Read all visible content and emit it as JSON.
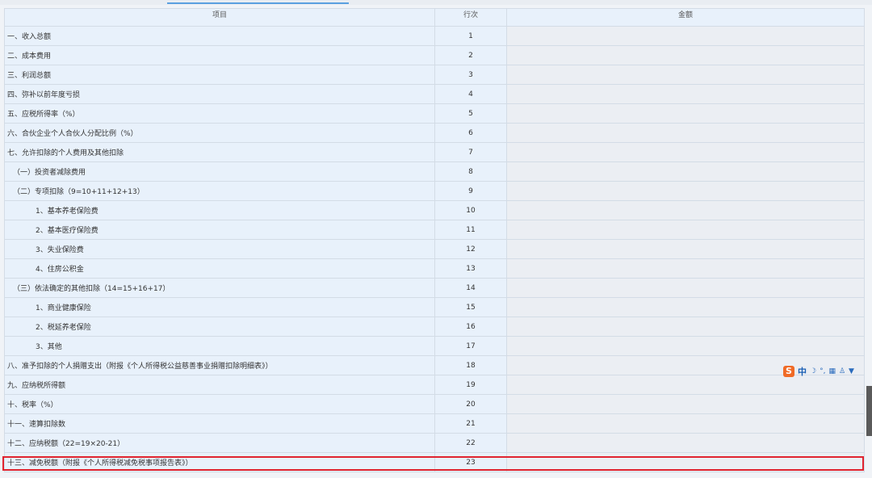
{
  "table": {
    "headers": {
      "item": "项目",
      "line": "行次",
      "amount": "金额"
    },
    "rows": [
      {
        "item": "一、收入总额",
        "line": "1",
        "indent": 0
      },
      {
        "item": "二、成本费用",
        "line": "2",
        "indent": 0
      },
      {
        "item": "三、利润总额",
        "line": "3",
        "indent": 0
      },
      {
        "item": "四、弥补以前年度亏损",
        "line": "4",
        "indent": 0
      },
      {
        "item": "五、应税所得率（%）",
        "line": "5",
        "indent": 0
      },
      {
        "item": "六、合伙企业个人合伙人分配比例（%）",
        "line": "6",
        "indent": 0
      },
      {
        "item": "七、允许扣除的个人费用及其他扣除",
        "line": "7",
        "indent": 0
      },
      {
        "item": "（一）投资者减除费用",
        "line": "8",
        "indent": 1
      },
      {
        "item": "（二）专项扣除（9=10+11+12+13）",
        "line": "9",
        "indent": 1
      },
      {
        "item": "1、基本养老保险费",
        "line": "10",
        "indent": 2
      },
      {
        "item": "2、基本医疗保险费",
        "line": "11",
        "indent": 2
      },
      {
        "item": "3、失业保险费",
        "line": "12",
        "indent": 2
      },
      {
        "item": "4、住房公积金",
        "line": "13",
        "indent": 2
      },
      {
        "item": "（三）依法确定的其他扣除（14=15+16+17）",
        "line": "14",
        "indent": 1
      },
      {
        "item": "1、商业健康保险",
        "line": "15",
        "indent": 2
      },
      {
        "item": "2、税延养老保险",
        "line": "16",
        "indent": 2
      },
      {
        "item": "3、其他",
        "line": "17",
        "indent": 2
      },
      {
        "item": "八、准予扣除的个人捐赠支出（附报《个人所得税公益慈善事业捐赠扣除明细表》）",
        "line": "18",
        "indent": 0
      },
      {
        "item": "九、应纳税所得额",
        "line": "19",
        "indent": 0
      },
      {
        "item": "十、税率（%）",
        "line": "20",
        "indent": 0
      },
      {
        "item": "十一、速算扣除数",
        "line": "21",
        "indent": 0
      },
      {
        "item": "十二、应纳税额（22=19×20-21）",
        "line": "22",
        "indent": 0
      },
      {
        "item": "十三、减免税额（附报《个人所得税减免税事项报告表》）",
        "line": "23",
        "indent": 0
      }
    ]
  },
  "ime_toolbar": {
    "logo_icon": "sogou-logo-icon",
    "mode_text": "中",
    "icons": [
      "moon-icon",
      "punctuation-icon",
      "keyboard-icon",
      "user-icon",
      "shirt-icon"
    ]
  },
  "colors": {
    "highlight_border": "#e0242f",
    "header_bg": "#e8f1fb",
    "amount_bg": "#ebeef3"
  }
}
